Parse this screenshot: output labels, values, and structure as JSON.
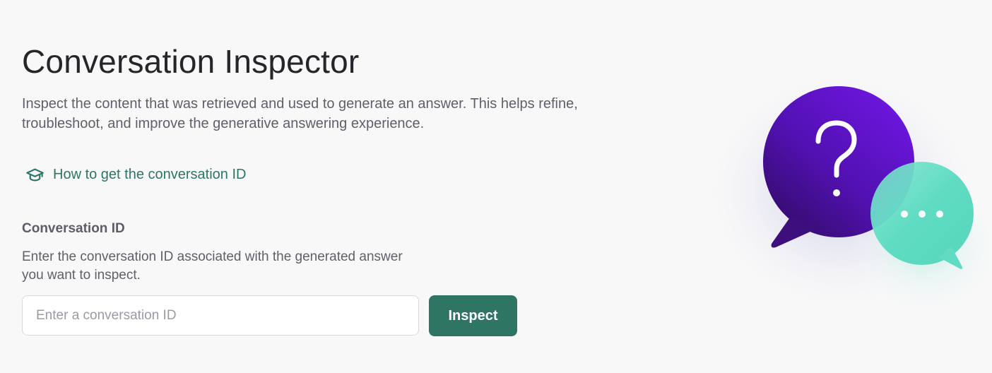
{
  "page": {
    "title": "Conversation Inspector",
    "description": "Inspect the content that was retrieved and used to generate an answer. This helps refine, troubleshoot, and improve the generative answering experience."
  },
  "help_link": {
    "label": "How to get the conversation ID",
    "icon": "graduation-cap-icon"
  },
  "conversation_field": {
    "label": "Conversation ID",
    "help_text": "Enter the conversation ID associated with the generated answer you want to inspect.",
    "placeholder": "Enter a conversation ID",
    "value": ""
  },
  "inspect_button": {
    "label": "Inspect"
  },
  "illustration": {
    "question_bubble_icon": "question-mark-icon",
    "reply_bubble_icon": "ellipsis-icon"
  },
  "colors": {
    "accent": "#2f7564",
    "background": "#f8f8f9",
    "bubble_purple_light": "#6a14d9",
    "bubble_purple_dark": "#3d0f7d",
    "bubble_mint": "#5fdcc2"
  }
}
